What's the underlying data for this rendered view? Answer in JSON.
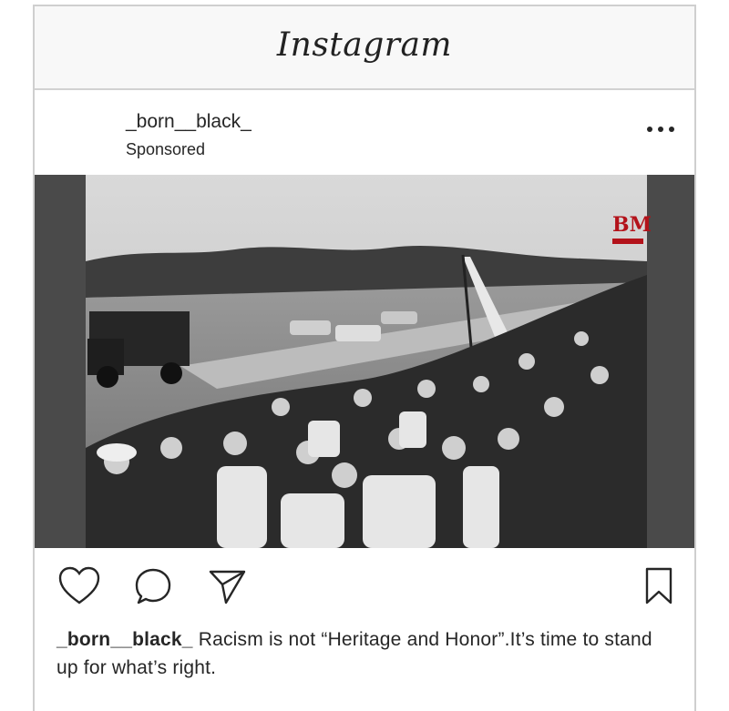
{
  "app": {
    "brand": "Instagram"
  },
  "post": {
    "username": "_born__black_",
    "sponsored_label": "Sponsored",
    "media_watermark": "BM",
    "caption_user": "_born__black_",
    "caption_text": " Racism is not “Heritage and Honor”.It’s time to stand up for what’s right."
  },
  "icons": {
    "more": "more-options-icon",
    "like": "heart-icon",
    "comment": "comment-icon",
    "share": "send-icon",
    "save": "bookmark-icon"
  }
}
